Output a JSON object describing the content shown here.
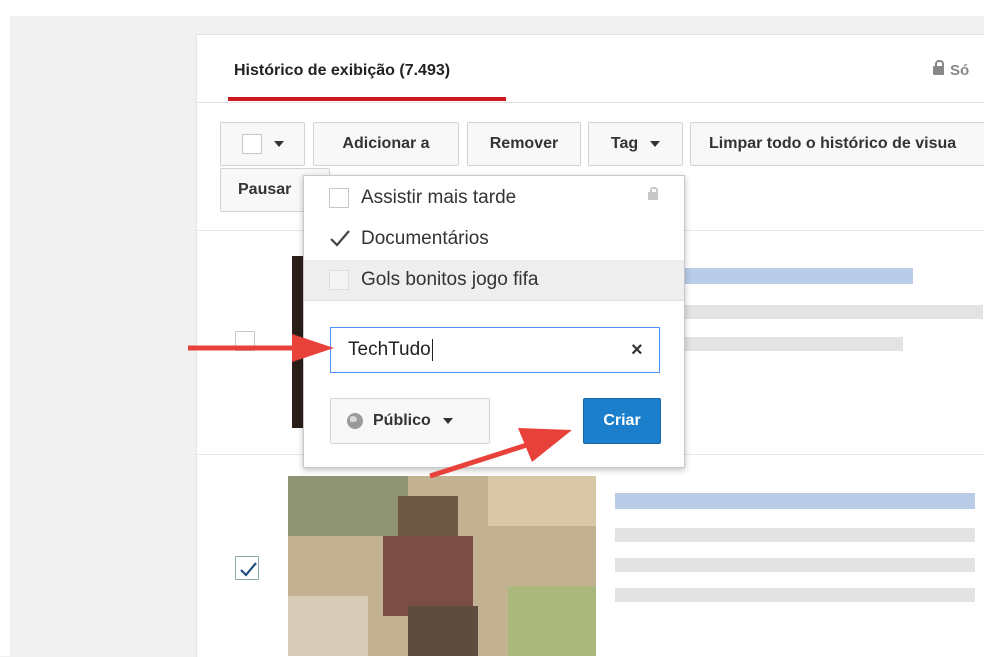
{
  "header": {
    "title": "Histórico de exibição (7.493)",
    "privacy": "Só"
  },
  "toolbar": {
    "add_to": "Adicionar a",
    "remove": "Remover",
    "tag": "Tag",
    "clear_history": "Limpar todo o histórico de visua",
    "pause": "Pausar"
  },
  "dropdown": {
    "playlists": [
      {
        "label": "Assistir mais tarde",
        "checked": false,
        "private": true
      },
      {
        "label": "Documentários",
        "checked": true,
        "private": false
      },
      {
        "label": "Gols bonitos jogo fifa",
        "checked": false,
        "private": false
      }
    ],
    "new_playlist_value": "TechTudo",
    "privacy_label": "Público",
    "create_label": "Criar"
  },
  "rows": [
    {
      "checked": false
    },
    {
      "checked": true
    }
  ],
  "colors": {
    "accent_red": "#cc181e",
    "create_blue": "#1b7fcc",
    "input_focus": "#4d90fe",
    "annotation_arrow": "#e8413a"
  },
  "icons": [
    "lock-icon",
    "caret-down-icon",
    "checkmark-icon",
    "globe-icon",
    "clear-x-icon"
  ]
}
